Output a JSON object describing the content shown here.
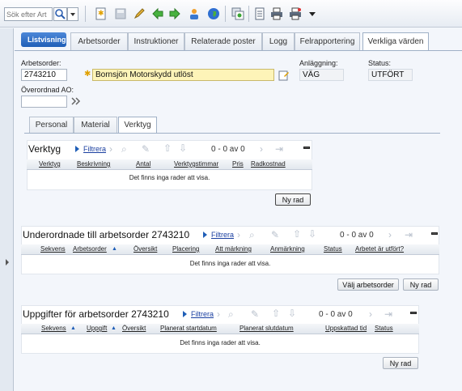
{
  "toolbar": {
    "search_placeholder": "Sök efter Art"
  },
  "tabs": {
    "list": "Listvisning",
    "items": [
      "Arbetsorder",
      "Instruktioner",
      "Relaterade poster",
      "Logg",
      "Felrapportering",
      "Verkliga värden"
    ]
  },
  "header": {
    "wo_label": "Arbetsorder:",
    "wo_value": "2743210",
    "desc_value": "Bornsjön Motorskydd utlöst",
    "asset_label": "Anläggning:",
    "asset_value": "VÄG",
    "status_label": "Status:",
    "status_value": "UTFÖRT",
    "parent_label": "Överordnad AO:",
    "parent_value": ""
  },
  "subtabs": [
    "Personal",
    "Material",
    "Verktyg"
  ],
  "tools": {
    "title": "Verktyg",
    "filter": "Filtrera",
    "nav": "0 - 0 av 0",
    "columns": [
      "Verktyg",
      "Beskrivning",
      "Antal",
      "Verktygstimmar",
      "Pris",
      "Radkostnad"
    ],
    "empty": "Det finns inga rader att visa.",
    "new_row": "Ny rad"
  },
  "children": {
    "title": "Underordnade till arbetsorder 2743210",
    "filter": "Filtrera",
    "nav": "0 - 0 av 0",
    "columns": [
      "Sekvens",
      "Arbetsorder",
      "Översikt",
      "Placering",
      "Att märkning",
      "Anmärkning",
      "Status",
      "Arbetet är utfört?"
    ],
    "empty": "Det finns inga rader att visa.",
    "select_wo": "Välj arbetsorder",
    "new_row": "Ny rad"
  },
  "tasks": {
    "title": "Uppgifter för arbetsorder 2743210",
    "filter": "Filtrera",
    "nav": "0 - 0 av 0",
    "columns": [
      "Sekvens",
      "Uppgift",
      "Översikt",
      "Planerat startdatum",
      "Planerat slutdatum",
      "Uppskattad tid",
      "Status"
    ],
    "empty": "Det finns inga rader att visa.",
    "new_row": "Ny rad"
  },
  "colors": {
    "accent": "#1f5eb7",
    "required_field": "#fdf4b8"
  }
}
